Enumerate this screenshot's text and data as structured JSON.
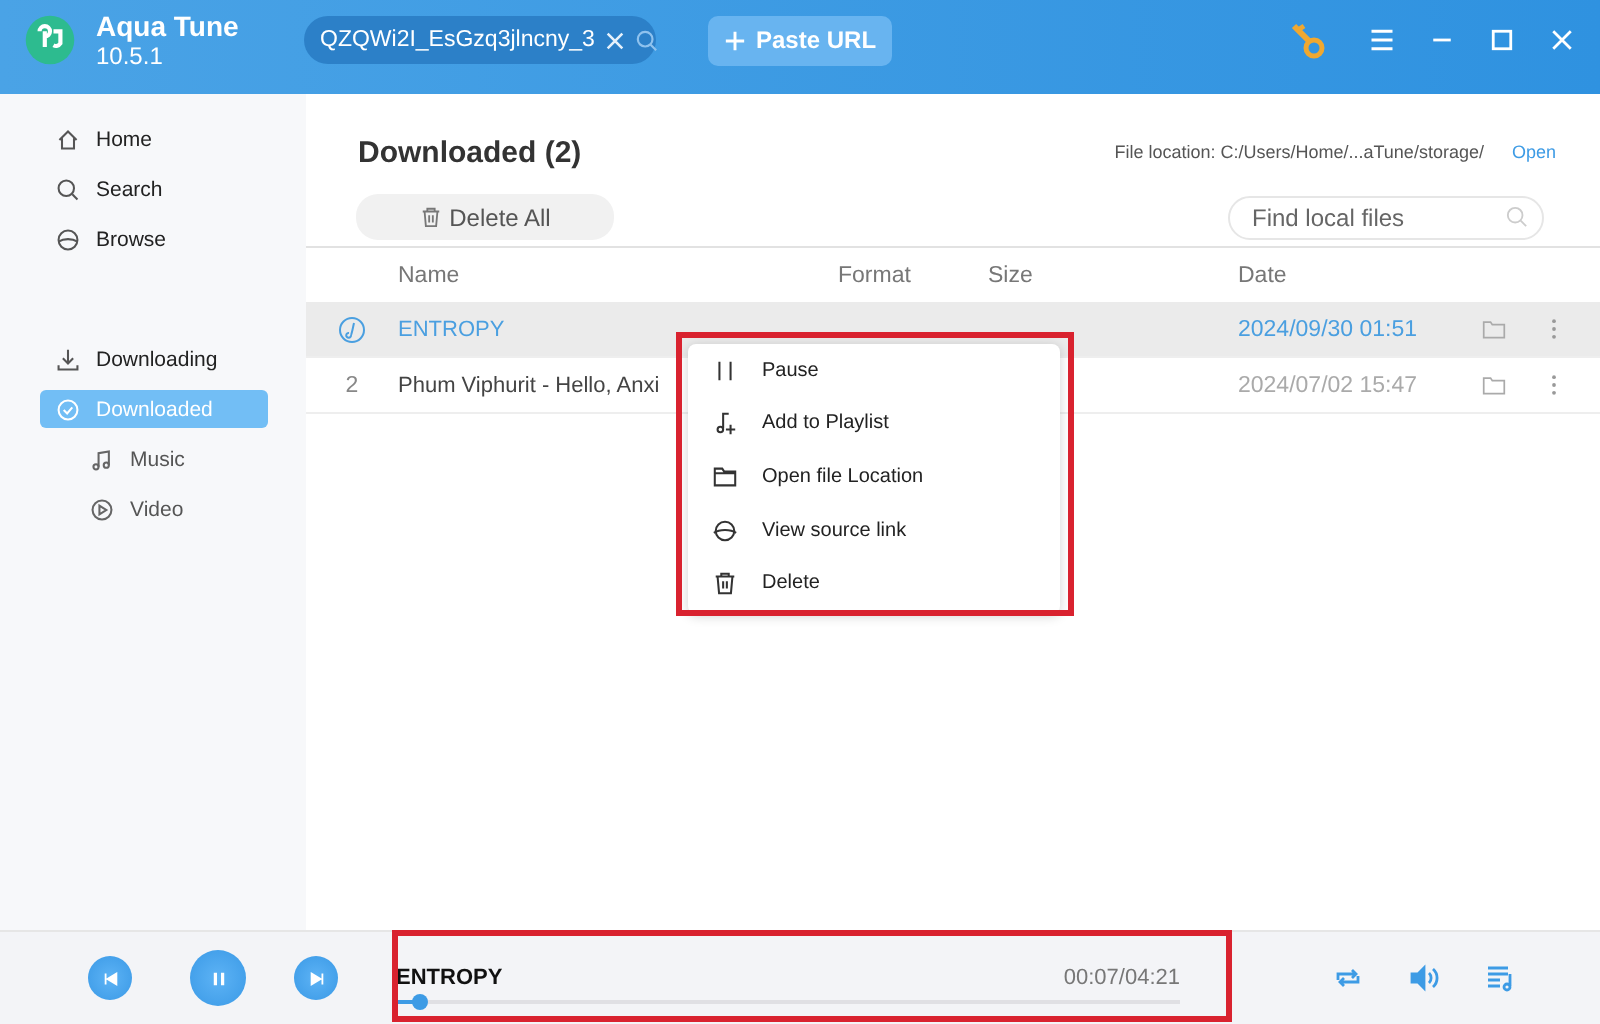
{
  "app": {
    "name": "Aqua Tune",
    "version": "10.5.1"
  },
  "url_field": {
    "value": "QZQWi2I_EsGzq3jlncny_3"
  },
  "paste_button": "Paste URL",
  "sidebar": {
    "nav": [
      {
        "label": "Home",
        "selected": false
      },
      {
        "label": "Search",
        "selected": false
      },
      {
        "label": "Browse",
        "selected": false
      }
    ],
    "library": [
      {
        "label": "Downloading",
        "selected": false
      },
      {
        "label": "Downloaded",
        "selected": true,
        "children": [
          {
            "label": "Music",
            "selected": false
          },
          {
            "label": "Video",
            "selected": false
          }
        ]
      }
    ]
  },
  "heading": "Downloaded (2)",
  "file_location": "File location: C:/Users/Home/...aTune/storage/",
  "open_link": "Open",
  "delete_all": "Delete All",
  "find_field": {
    "placeholder": "Find local files"
  },
  "table": {
    "columns": [
      "Name",
      "Format",
      "Size",
      "Date"
    ],
    "rows": [
      {
        "kind": "playing",
        "name": "ENTROPY",
        "date": "2024/09/30 01:51",
        "selected": true
      },
      {
        "kind": "track",
        "index": "2",
        "name": "Phum Viphurit - Hello, Anxi",
        "date": "2024/07/02 15:47",
        "selected": false
      }
    ]
  },
  "context_menu": [
    "Pause",
    "Add to Playlist",
    "Open file Location",
    "View source link",
    "Delete"
  ],
  "player": {
    "title": "ENTROPY",
    "time": "00:07/04:21",
    "level": 0.03
  }
}
